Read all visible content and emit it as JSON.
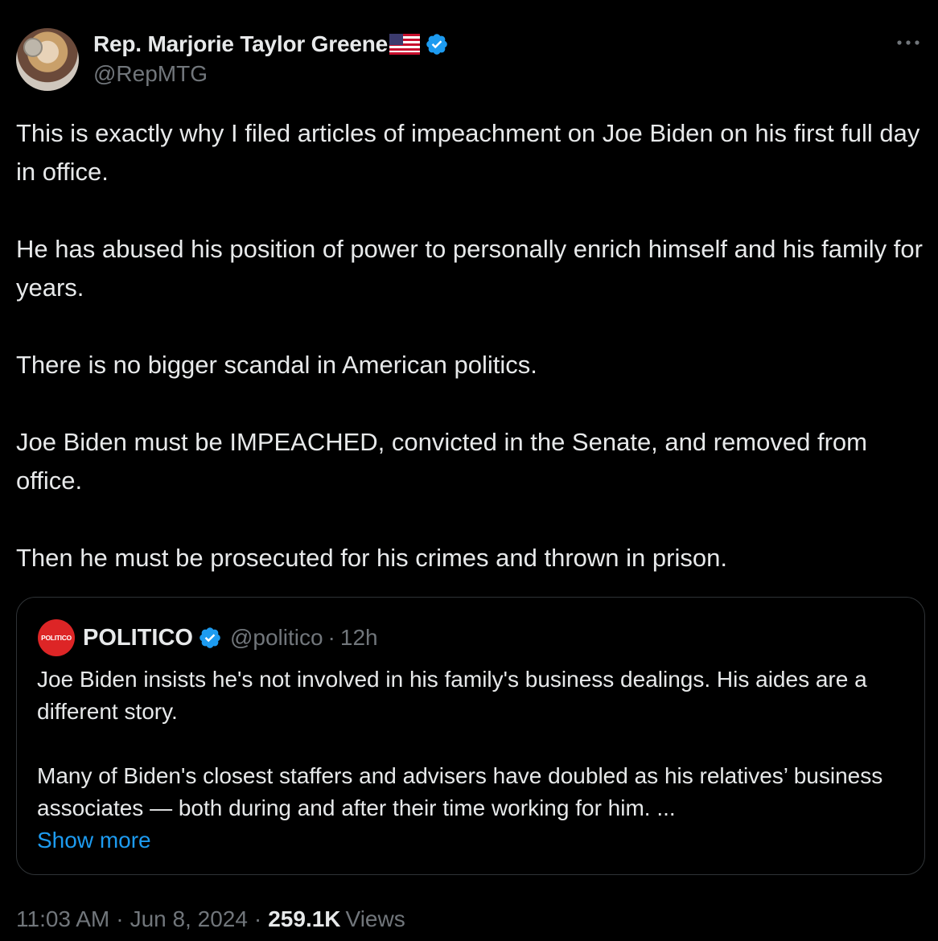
{
  "tweet": {
    "author": {
      "name": "Rep. Marjorie Taylor Greene",
      "handle": "@RepMTG"
    },
    "body": [
      "This is exactly why I filed articles of impeachment on Joe Biden on his first full day in office.",
      "He has abused his position of power to personally enrich himself and his family for years.",
      "There is no bigger scandal in American politics.",
      "Joe Biden must be IMPEACHED, convicted in the Senate, and removed from office.",
      "Then he must be prosecuted for his crimes and thrown in prison."
    ],
    "quote": {
      "logo_text": "POLITICO",
      "name": "POLITICO",
      "handle": "@politico",
      "time": "12h",
      "body": [
        "Joe Biden insists he's not involved in his family's business dealings. His aides are a different story.",
        "Many of Biden's closest staffers and advisers have doubled as his relatives’ business associates — both during and after their time working for him. ..."
      ],
      "show_more": "Show more"
    },
    "meta": {
      "time": "11:03 AM",
      "date": "Jun 8, 2024",
      "views_count": "259.1K",
      "views_label": "Views"
    }
  },
  "colors": {
    "background": "#000000",
    "text": "#e7e9ea",
    "muted": "#71767b",
    "link": "#1d9bf0",
    "verified": "#1d9bf0",
    "politico_red": "#dd2526"
  },
  "icons": {
    "verified": "verified-badge-icon",
    "flag": "us-flag-icon",
    "more": "more-dots-icon"
  }
}
